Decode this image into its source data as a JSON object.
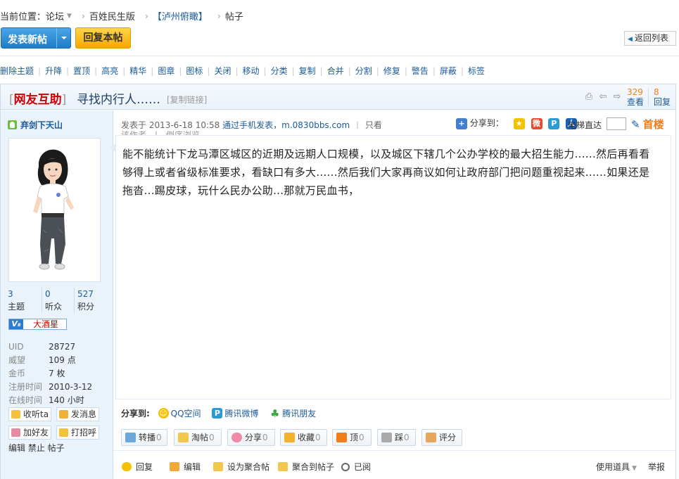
{
  "breadcrumb": {
    "prefix": "当前位置：",
    "forum": "论坛",
    "section": "百姓民生版",
    "subforum": "【泸州俯瞰】",
    "current": "帖子"
  },
  "actions": {
    "new_post": "发表新帖",
    "reply": "回复本帖",
    "back": "返回列表"
  },
  "mod_tools": [
    "删除主题",
    "升降",
    "置顶",
    "高亮",
    "精华",
    "图章",
    "图标",
    "关闭",
    "移动",
    "分类",
    "复制",
    "合并",
    "分割",
    "修复",
    "警告",
    "屏蔽",
    "标签"
  ],
  "thread": {
    "tag": "网友互助",
    "title": "寻找内行人……",
    "copy_link": "[复制链接]",
    "views": "329",
    "views_label": "查看",
    "replies": "8",
    "replies_label": "回复"
  },
  "author": {
    "name": "弃剑下天山",
    "topics": "3",
    "topics_label": "主题",
    "followers": "0",
    "followers_label": "听众",
    "points": "527",
    "points_label": "积分",
    "level": "大酒星",
    "uid_label": "UID",
    "uid": "28727",
    "prestige_label": "威望",
    "prestige": "109 点",
    "coins_label": "金币",
    "coins": "7 枚",
    "reg_label": "注册时间",
    "reg": "2010-3-12",
    "online_label": "在线时间",
    "online": "140 小时",
    "btn_follow": "收听ta",
    "btn_message": "发消息",
    "btn_friend": "加好友",
    "btn_greet": "打招呼",
    "admin_actions": "编辑 禁止 帖子"
  },
  "post": {
    "posted_at": "发表于 2013-6-18 10:58",
    "via": "通过手机发表，m.0830bbs.com",
    "view_only": "只看",
    "share_label": "分享到：",
    "elevator": "电梯直达",
    "floor": "首楼",
    "body": "能不能统计下龙马潭区城区的近期及远期人口规模，以及城区下辖几个公办学校的最大招生能力......然后再看看够得上或者省级标准要求，看缺口有多大......然后我们大家再商议如何让政府部门把问题重视起来......如果还是拖沓...踢皮球，玩什么民办公助...那就万民血书，"
  },
  "share_bottom": {
    "label": "分享到:",
    "qq_zone": "QQ空间",
    "tencent_weibo": "腾讯微博",
    "tencent_friend": "腾讯朋友"
  },
  "vote_buttons": [
    {
      "label": "转播",
      "count": "0"
    },
    {
      "label": "淘帖",
      "count": "0"
    },
    {
      "label": "分享",
      "count": "0"
    },
    {
      "label": "收藏",
      "count": "0"
    },
    {
      "label": "顶",
      "count": "0"
    },
    {
      "label": "踩",
      "count": "0"
    },
    {
      "label": "评分",
      "count": ""
    }
  ],
  "footer": {
    "reply": "回复",
    "edit": "编辑",
    "set_collection": "设为聚合帖",
    "add_collection": "聚合到帖子",
    "read": "已阅",
    "tools": "使用道具",
    "report": "举报"
  },
  "colors": {
    "link": "#1a5a99",
    "accent_orange": "#f07e1a",
    "brand_blue": "#1f7cc7",
    "reply_yellow": "#f7a800",
    "tag_red": "#cc0000"
  }
}
